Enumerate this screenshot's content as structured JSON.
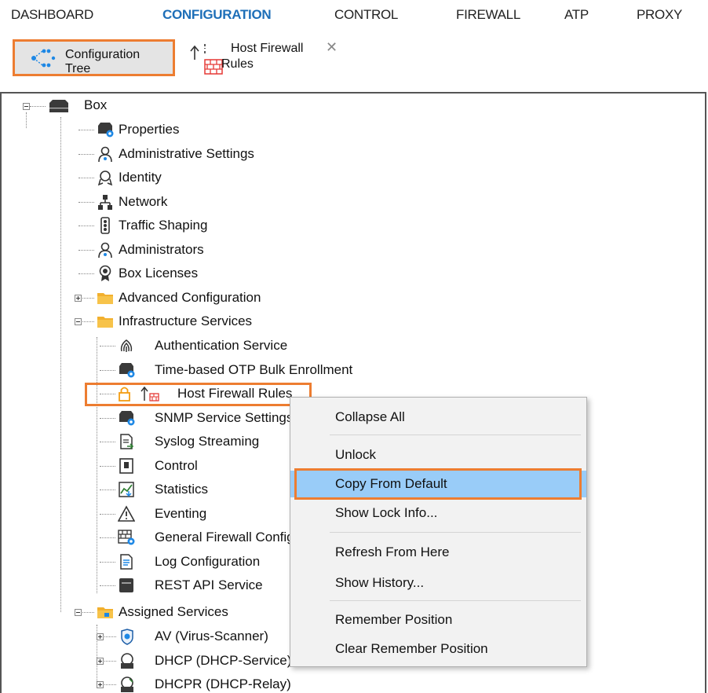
{
  "nav": {
    "tabs": [
      "DASHBOARD",
      "CONFIGURATION",
      "CONTROL",
      "FIREWALL",
      "ATP",
      "PROXY"
    ],
    "active": "CONFIGURATION"
  },
  "toolbar": {
    "config_tree_line1": "Configuration",
    "config_tree_line2": "Tree",
    "host_fw_line1": "Host Firewall",
    "host_fw_line2": "Rules",
    "close_glyph": "✕"
  },
  "tree": {
    "box": "Box",
    "box_children": [
      "Properties",
      "Administrative Settings",
      "Identity",
      "Network",
      "Traffic Shaping",
      "Administrators",
      "Box Licenses",
      "Advanced Configuration",
      "Infrastructure Services"
    ],
    "infra_children": [
      "Authentication Service",
      "Time-based OTP Bulk Enrollment",
      "Host Firewall Rules",
      "SNMP Service Settings",
      "Syslog Streaming",
      "Control",
      "Statistics",
      "Eventing",
      "General Firewall Configuration",
      "Log Configuration",
      "REST API Service"
    ],
    "assigned": "Assigned Services",
    "assigned_children": [
      "AV (Virus-Scanner)",
      "DHCP (DHCP-Service)",
      "DHCPR (DHCP-Relay)"
    ]
  },
  "context_menu": {
    "items": [
      "Collapse All",
      "Unlock",
      "Copy From Default",
      "Show Lock Info...",
      "Refresh From Here",
      "Show History...",
      "Remember Position",
      "Clear Remember Position"
    ],
    "selected": "Copy From Default"
  },
  "colors": {
    "accent": "#1e6fb8",
    "highlight": "#ed7d31",
    "selection": "#99ccf8"
  }
}
